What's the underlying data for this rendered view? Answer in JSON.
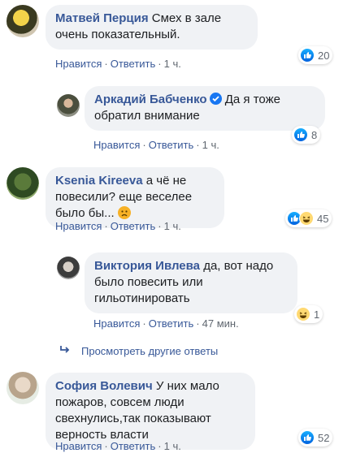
{
  "actions": {
    "like": "Нравится",
    "reply": "Ответить",
    "sep": "·"
  },
  "comments": [
    {
      "author": "Матвей Перция",
      "text": "Смех в зале очень показательный.",
      "time": "1 ч.",
      "reactions": "20"
    },
    {
      "author": "Аркадий Бабченко",
      "text": "Да я тоже обратил внимание",
      "time": "1 ч.",
      "reactions": "8"
    },
    {
      "author": "Ksenia Kireeva",
      "text": "а чё не повесили? еще веселее было бы...",
      "time": "1 ч.",
      "reactions": "45"
    },
    {
      "author": "Виктория Ивлева",
      "text": "да, вот надо было повесить или гильотинировать",
      "time": "47 мин.",
      "reactions": "1"
    },
    {
      "author": "София Волевич",
      "text": "У них мало пожаров, совсем люди свехнулись,так показывают верность власти",
      "time": "1 ч.",
      "reactions": "52"
    }
  ],
  "more_replies": "Просмотреть другие ответы",
  "colors": {
    "link": "#385898",
    "bubble": "#f0f2f5",
    "like": "#1877f2"
  }
}
